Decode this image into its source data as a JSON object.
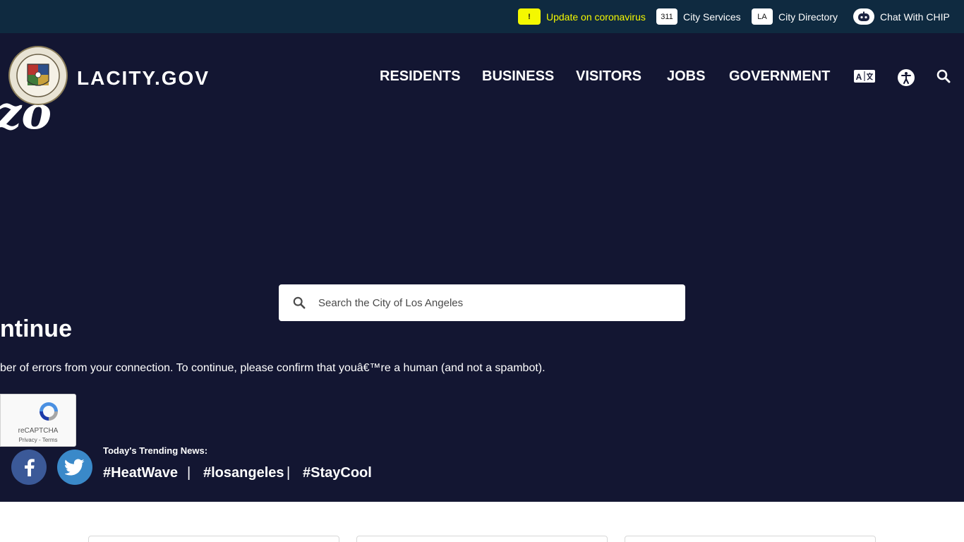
{
  "topbar": {
    "alert": {
      "badge": "!",
      "label": "Update on coronavirus"
    },
    "services": {
      "badge": "311",
      "label": "City Services"
    },
    "directory": {
      "badge": "LA",
      "label": "City Directory"
    },
    "chat": {
      "label": "Chat With CHIP"
    }
  },
  "header": {
    "brand": "LACITY.GOV",
    "nav": [
      "RESIDENTS",
      "BUSINESS",
      "VISITORS",
      "JOBS",
      "GOVERNMENT"
    ],
    "icons": [
      "translate-icon",
      "accessibility-icon",
      "search-icon"
    ]
  },
  "background": {
    "fragment": "zo"
  },
  "search": {
    "placeholder": "Search the City of Los Angeles"
  },
  "error": {
    "title": "ntinue",
    "message": "ber of errors from your connection. To continue, please confirm that youâ€™re a human (and not a spambot)."
  },
  "recaptcha": {
    "name": "reCAPTCHA",
    "links": "Privacy - Terms"
  },
  "trending": {
    "label": "Today's Trending News:",
    "tags": [
      "#HeatWave",
      "#losangeles",
      "#StayCool"
    ],
    "separator": "|"
  },
  "colors": {
    "topbar": "#0f2a40",
    "hero": "#131632",
    "alert": "#f4f800",
    "facebook": "#3b5998",
    "twitter": "#3a89c9"
  }
}
